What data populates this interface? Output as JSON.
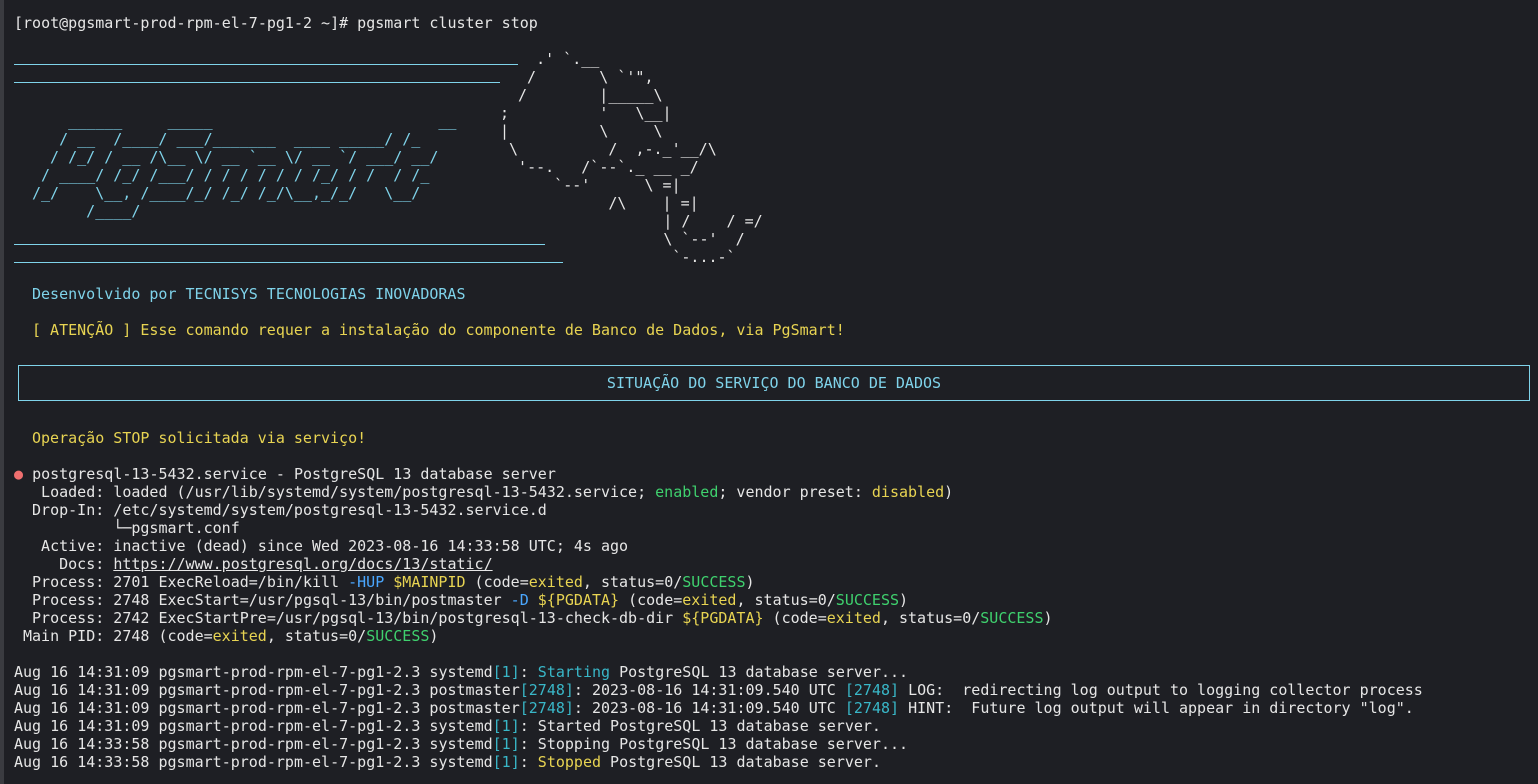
{
  "prompt": "[root@pgsmart-prod-rpm-el-7-pg1-2 ~]# pgsmart cluster stop",
  "logo_lines": [
    "    ______     _____                         __",
    "   / __  /____/ ___/_______  ____ _____/ /_",
    "  / /_/ / __ /\\__ \\/ __ `__ \\/ __ `/ ___/ __/",
    " / ____/ /_/ /___/ / / / / / / /_/ / /  / /_",
    "/_/    \\__, /____/_/ /_/ /_/\\__,_/_/   \\__/",
    "      /____/"
  ],
  "elephant_lines": [
    "   .' `.__",
    "  /       \\ `'\",",
    " /        |_____\\",
    ";          '   \\__|",
    "|          \\     \\",
    " \\          /  ,-._'__/\\",
    "  '--.   /`--`._ __ _/",
    "      `--'      \\ =|",
    "            /\\    | =|",
    "           | /    / =/",
    "           \\ `--'  /",
    "            `-...-`"
  ],
  "developer": "Desenvolvido por TECNISYS TECNOLOGIAS INOVADORAS",
  "warning": "[ ATENÇÃO ] Esse comando requer a instalação do componente de Banco de Dados, via PgSmart!",
  "section_title": "SITUAÇÃO DO SERVIÇO DO BANCO DE DADOS",
  "operation": "Operação STOP solicitada via serviço!",
  "service": {
    "bullet": "●",
    "name_line": "postgresql-13-5432.service - PostgreSQL 13 database server",
    "loaded_prefix": "  Loaded: loaded (/usr/lib/systemd/system/postgresql-13-5432.service; ",
    "loaded_enabled": "enabled",
    "loaded_mid": "; vendor preset: ",
    "loaded_disabled": "disabled",
    "loaded_suffix": ")",
    "dropin": " Drop-In: /etc/systemd/system/postgresql-13-5432.service.d",
    "dropin_file": "          └─pgsmart.conf",
    "active": "  Active: inactive (dead) since Wed 2023-08-16 14:33:58 UTC; 4s ago",
    "docs_label": "    Docs: ",
    "docs_url": "https://www.postgresql.org/docs/13/static/",
    "p1_a": " Process: 2701 ExecReload=/bin/kill ",
    "p1_hup": "-HUP",
    "p1_sp": " ",
    "p1_pid": "$MAINPID",
    "p1_b": " (code=",
    "p1_exited": "exited",
    "p1_c": ", status=0/",
    "p1_success": "SUCCESS",
    "p1_d": ")",
    "p2_a": " Process: 2748 ExecStart=/usr/pgsql-13/bin/postmaster ",
    "p2_d": "-D",
    "p2_sp": " ",
    "p2_var": "${PGDATA}",
    "p2_b": " (code=",
    "p2_exited": "exited",
    "p2_c": ", status=0/",
    "p2_success": "SUCCESS",
    "p2_e": ")",
    "p3_a": " Process: 2742 ExecStartPre=/usr/pgsql-13/bin/postgresql-13-check-db-dir ",
    "p3_var": "${PGDATA}",
    "p3_b": " (code=",
    "p3_exited": "exited",
    "p3_c": ", status=0/",
    "p3_success": "SUCCESS",
    "p3_d": ")",
    "main_a": "Main PID: 2748 (code=",
    "main_exited": "exited",
    "main_c": ", status=0/",
    "main_success": "SUCCESS",
    "main_d": ")"
  },
  "logs": [
    {
      "prefix": "Aug 16 14:31:09 pgsmart-prod-rpm-el-7-pg1-2.3 systemd",
      "pid": "[1]",
      "sep": ": ",
      "status": "Starting",
      "text": " PostgreSQL 13 database server..."
    },
    {
      "prefix": "Aug 16 14:31:09 pgsmart-prod-rpm-el-7-pg1-2.3 postmaster",
      "pid": "[2748]",
      "sep": ": 2023-08-16 14:31:09.540 UTC ",
      "pid2": "[2748]",
      "text": " LOG:  redirecting log output to logging collector process"
    },
    {
      "prefix": "Aug 16 14:31:09 pgsmart-prod-rpm-el-7-pg1-2.3 postmaster",
      "pid": "[2748]",
      "sep": ": 2023-08-16 14:31:09.540 UTC ",
      "pid2": "[2748]",
      "text": " HINT:  Future log output will appear in directory \"log\"."
    },
    {
      "prefix": "Aug 16 14:31:09 pgsmart-prod-rpm-el-7-pg1-2.3 systemd",
      "pid": "[1]",
      "sep": ": ",
      "text": "Started PostgreSQL 13 database server."
    },
    {
      "prefix": "Aug 16 14:33:58 pgsmart-prod-rpm-el-7-pg1-2.3 systemd",
      "pid": "[1]",
      "sep": ": ",
      "text": "Stopping PostgreSQL 13 database server..."
    },
    {
      "prefix": "Aug 16 14:33:58 pgsmart-prod-rpm-el-7-pg1-2.3 systemd",
      "pid": "[1]",
      "sep": ": ",
      "status": "Stopped",
      "text": " PostgreSQL 13 database server."
    }
  ],
  "colors": {
    "background": "#1e1f24",
    "cyan": "#7fd3ea",
    "yellow": "#e8d452",
    "green": "#3fd16e",
    "blue": "#4aa7ff",
    "teal": "#39b7c8",
    "bullet_red": "#ef6f6f"
  }
}
